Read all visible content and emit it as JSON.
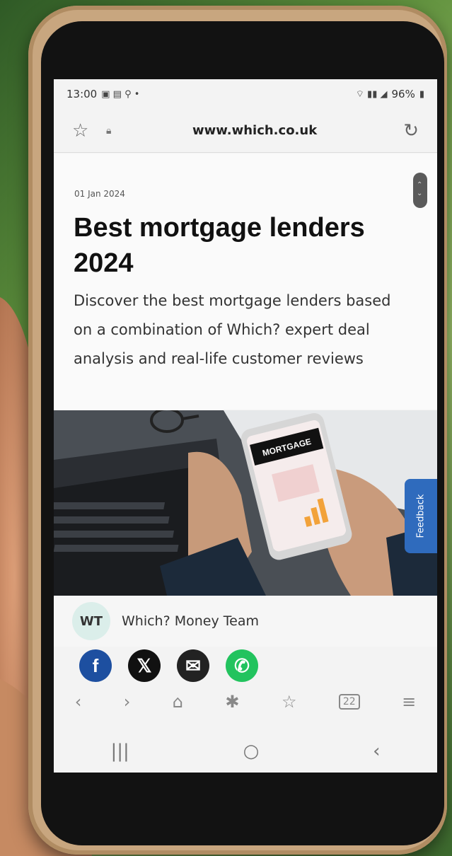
{
  "status_bar": {
    "time": "13:00",
    "battery": "96%"
  },
  "browser": {
    "url": "www.which.co.uk"
  },
  "article": {
    "date": "01 Jan 2024",
    "title": "Best mortgage lenders 2024",
    "description": "Discover the best mortgage lenders based on a combination of Which? expert deal analysis and real-life customer reviews",
    "hero_phone_text": "MORTGAGE"
  },
  "feedback_label": "Feedback",
  "author": {
    "initials": "WT",
    "name": "Which? Money Team"
  },
  "share": {
    "facebook": "f",
    "x": "𝕏",
    "email": "✉",
    "whatsapp": "✆"
  },
  "toolbar": {
    "back": "‹",
    "forward": "›",
    "home": "⌂",
    "extensions": "✱",
    "bookmarks": "☆",
    "tabs": "22",
    "menu": "≡"
  },
  "nav": {
    "recents": "|||",
    "home": "○",
    "back": "‹"
  }
}
